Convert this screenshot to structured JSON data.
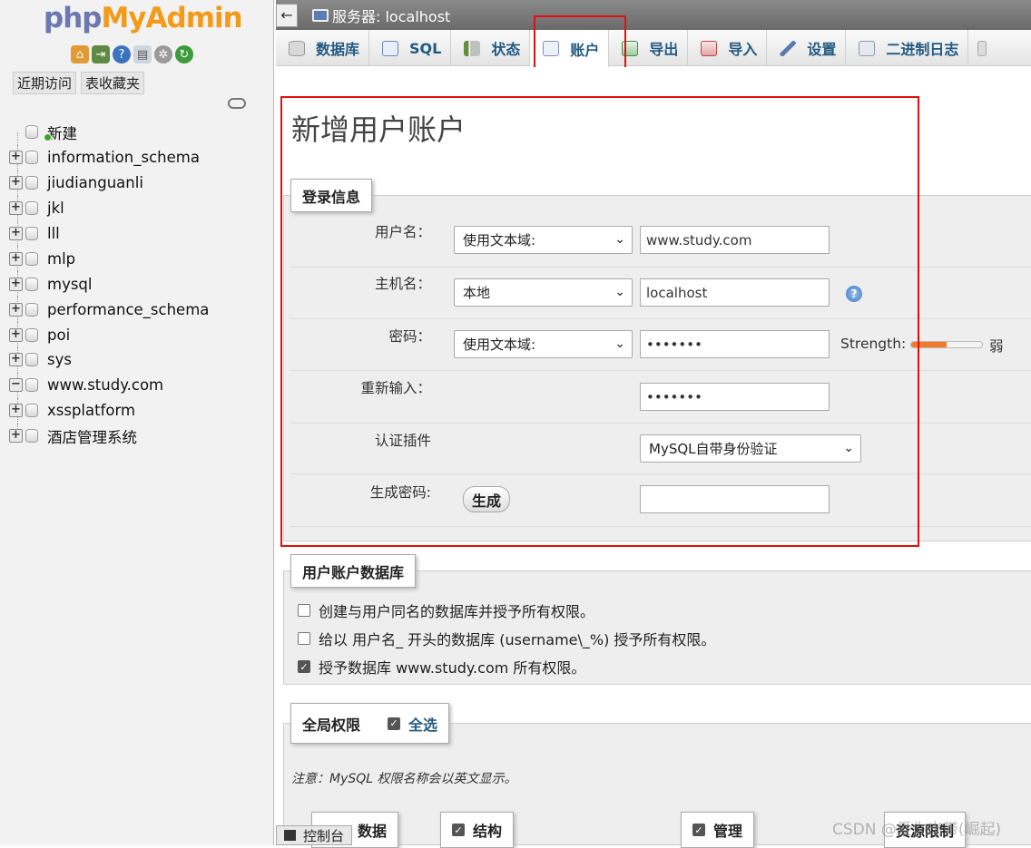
{
  "nav": {
    "logo_php": "php",
    "logo_myadmin": "MyAdmin",
    "recent_tab": "近期访问",
    "favorites_tab": "表收藏夹",
    "tree": [
      {
        "label": "新建",
        "type": "new"
      },
      {
        "label": "information_schema",
        "type": "db"
      },
      {
        "label": "jiudianguanli",
        "type": "db"
      },
      {
        "label": "jkl",
        "type": "db"
      },
      {
        "label": "lll",
        "type": "db"
      },
      {
        "label": "mlp",
        "type": "db"
      },
      {
        "label": "mysql",
        "type": "db"
      },
      {
        "label": "performance_schema",
        "type": "db"
      },
      {
        "label": "poi",
        "type": "db"
      },
      {
        "label": "sys",
        "type": "db"
      },
      {
        "label": "www.study.com",
        "type": "db-expanded"
      },
      {
        "label": "xssplatform",
        "type": "db"
      },
      {
        "label": "酒店管理系统",
        "type": "db"
      }
    ]
  },
  "topbar": {
    "server": "服务器: localhost"
  },
  "tabs": [
    {
      "label": "数据库",
      "icon": "database-icon",
      "color": "#cfcfcf"
    },
    {
      "label": "SQL",
      "icon": "sql-icon",
      "color": "#8fa8c8"
    },
    {
      "label": "状态",
      "icon": "status-icon",
      "color": "#6f8f4f"
    },
    {
      "label": "账户",
      "icon": "accounts-icon",
      "color": "#9db3d6",
      "active": true
    },
    {
      "label": "导出",
      "icon": "export-icon",
      "color": "#3e8e3e"
    },
    {
      "label": "导入",
      "icon": "import-icon",
      "color": "#c04545"
    },
    {
      "label": "设置",
      "icon": "wrench-icon",
      "color": "#5a7ab0"
    },
    {
      "label": "二进制日志",
      "icon": "binlog-icon",
      "color": "#8a9ab5"
    }
  ],
  "page": {
    "title": "新增用户账户"
  },
  "login": {
    "legend": "登录信息",
    "username_label": "用户名：",
    "username_type": "使用文本域:",
    "username_value": "www.study.com",
    "host_label": "主机名：",
    "host_type": "本地",
    "host_value": "localhost",
    "password_label": "密码：",
    "password_type": "使用文本域:",
    "password_value": "•••••••",
    "strength_label": "Strength:",
    "strength_level": 0.5,
    "strength_text": "弱",
    "retype_label": "重新输入：",
    "retype_value": "•••••••",
    "auth_label": "认证插件",
    "auth_value": "MySQL自带身份验证",
    "generate_label": "生成密码:",
    "generate_button": "生成",
    "generate_value": ""
  },
  "userdb": {
    "legend": "用户账户数据库",
    "option1": "创建与用户同名的数据库并授予所有权限。",
    "option2": "给以 用户名_ 开头的数据库 (username\\_%) 授予所有权限。",
    "option3": "授予数据库 www.study.com 所有权限。",
    "option3_checked": true
  },
  "global": {
    "legend": "全局权限",
    "select_all": "全选",
    "note": "注意：MySQL 权限名称会以英文显示。",
    "groups": [
      "数据",
      "结构",
      "管理",
      "资源限制"
    ]
  },
  "console": {
    "label": "控制台"
  },
  "watermark": "CSDN @爱你出带(崛起)"
}
